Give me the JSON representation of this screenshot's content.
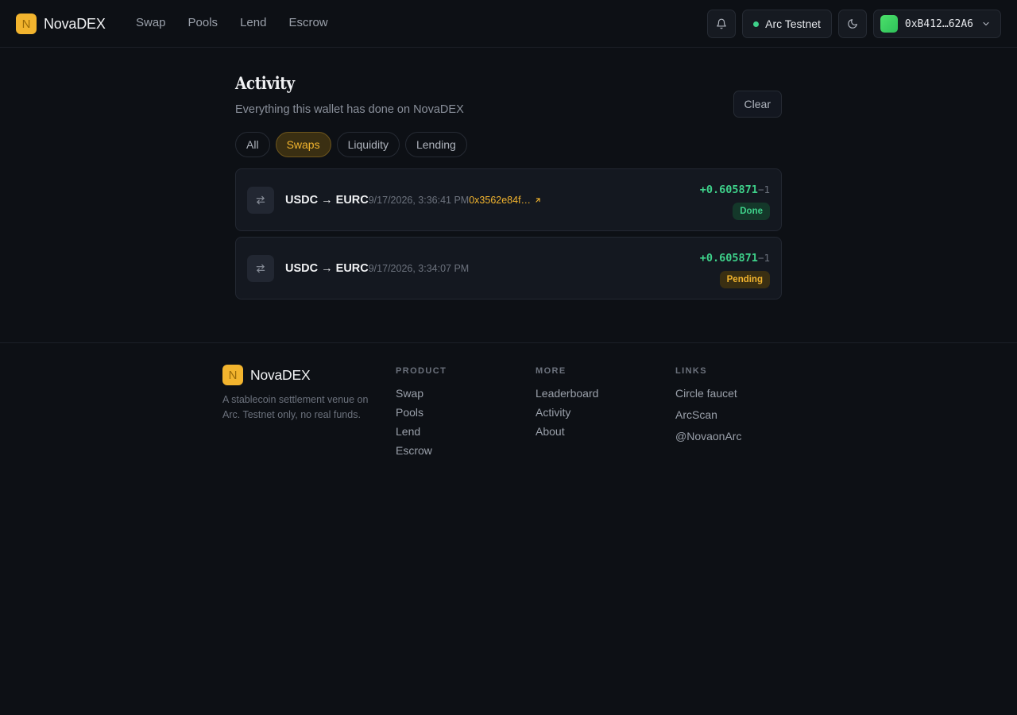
{
  "header": {
    "logo_letter": "N",
    "brand": "NovaDEX",
    "nav": [
      "Swap",
      "Pools",
      "Lend",
      "Escrow"
    ],
    "network": "Arc Testnet",
    "wallet_address": "0xB412…62A6",
    "icons": {
      "notifications": "bell-icon",
      "theme": "moon-icon",
      "wallet_menu": "chevron-down-icon"
    }
  },
  "page": {
    "title": "Activity",
    "subtitle": "Everything this wallet has done on NovaDEX",
    "clear_label": "Clear",
    "filters": [
      "All",
      "Swaps",
      "Liquidity",
      "Lending"
    ],
    "active_filter": "Swaps"
  },
  "activity": [
    {
      "pair": "USDC → EURC",
      "time": "9/17/2026, 3:36:41 PM",
      "hash": "0x3562e84f…",
      "amount": "+0.605871",
      "debit": "−1",
      "status": "Done"
    },
    {
      "pair": "USDC → EURC",
      "time": "9/17/2026, 3:34:07 PM",
      "hash": "",
      "amount": "+0.605871",
      "debit": "−1",
      "status": "Pending"
    }
  ],
  "footer": {
    "logo_letter": "N",
    "brand": "NovaDEX",
    "tagline": "A stablecoin settlement venue on Arc. Testnet only, no real funds.",
    "product": {
      "title": "PRODUCT",
      "links": [
        "Swap",
        "Pools",
        "Lend",
        "Escrow"
      ]
    },
    "more": {
      "title": "MORE",
      "links": [
        "Leaderboard",
        "Activity",
        "About"
      ]
    },
    "links": {
      "title": "LINKS",
      "links": [
        "Circle faucet",
        "ArcScan",
        "@NovaonArc"
      ]
    }
  },
  "colors": {
    "accent": "#f2b42e",
    "success": "#3ed18a",
    "background": "#0d1015"
  }
}
